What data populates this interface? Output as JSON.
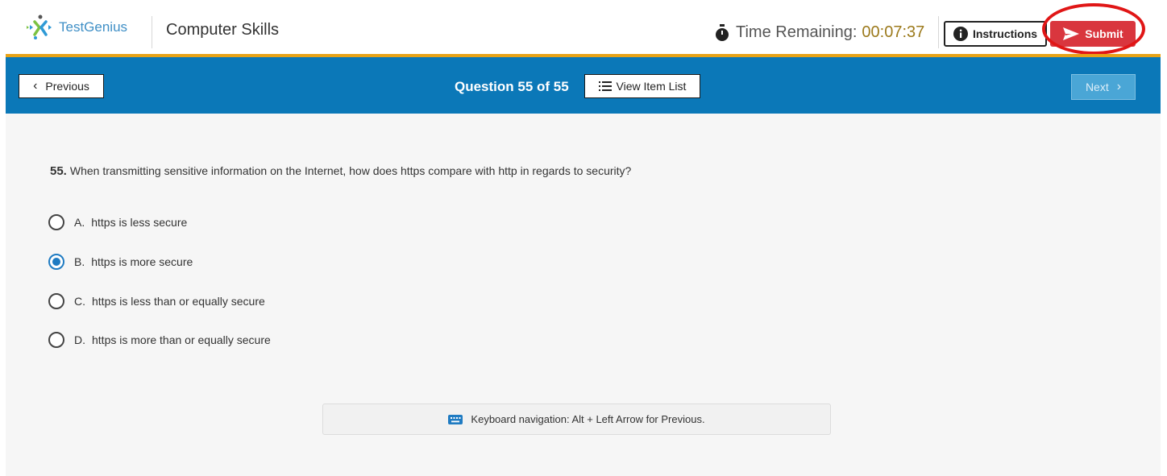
{
  "header": {
    "logo_text": "TestGenius",
    "app_title": "Computer Skills",
    "timer_label": "Time Remaining:",
    "timer_value": "00:07:37",
    "instructions_label": "Instructions",
    "submit_label": "Submit"
  },
  "nav": {
    "previous_label": "Previous",
    "question_counter": "Question 55 of 55",
    "item_list_label": "View Item List",
    "next_label": "Next"
  },
  "question": {
    "number": "55.",
    "text": "When transmitting sensitive information on the Internet, how does https compare with http in regards to security?",
    "options": [
      {
        "letter": "A.",
        "text": "https is less secure",
        "selected": false
      },
      {
        "letter": "B.",
        "text": "https is more secure",
        "selected": true
      },
      {
        "letter": "C.",
        "text": "https is less than or equally secure",
        "selected": false
      },
      {
        "letter": "D.",
        "text": "https is more than or equally secure",
        "selected": false
      }
    ]
  },
  "hint": {
    "icon": "keyboard-icon",
    "text": "Keyboard navigation: Alt + Left Arrow for Previous."
  },
  "colors": {
    "nav_blue": "#0b78b8",
    "accent_gold": "#e8a317",
    "submit_red": "#d9363e",
    "timer_gold": "#9c7a1c",
    "radio_blue": "#1f7bc2"
  }
}
